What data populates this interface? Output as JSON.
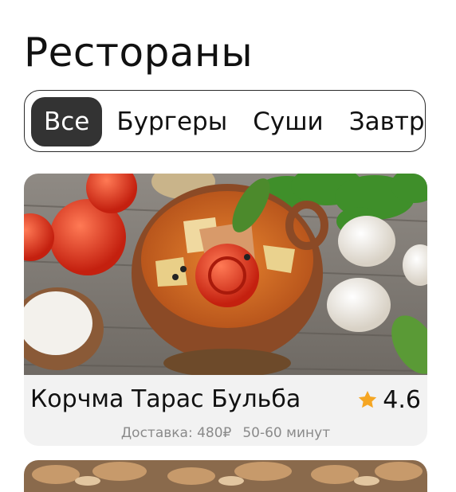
{
  "header": {
    "title": "Рестораны"
  },
  "categories": [
    {
      "label": "Все",
      "active": true
    },
    {
      "label": "Бургеры",
      "active": false
    },
    {
      "label": "Суши",
      "active": false
    },
    {
      "label": "Завтраки",
      "active": false
    }
  ],
  "restaurants": [
    {
      "name": "Корчма Тарас Бульба",
      "rating": "4.6",
      "delivery": "Доставка: 480₽",
      "time": "50-60 минут",
      "image_icon": "soup-bowl-photo"
    },
    {
      "image_icon": "food-photo"
    }
  ],
  "colors": {
    "accent_chip": "#333333",
    "star": "#f5a623",
    "card_bg": "#f2f2f2",
    "meta_text": "#8a8a8a"
  }
}
